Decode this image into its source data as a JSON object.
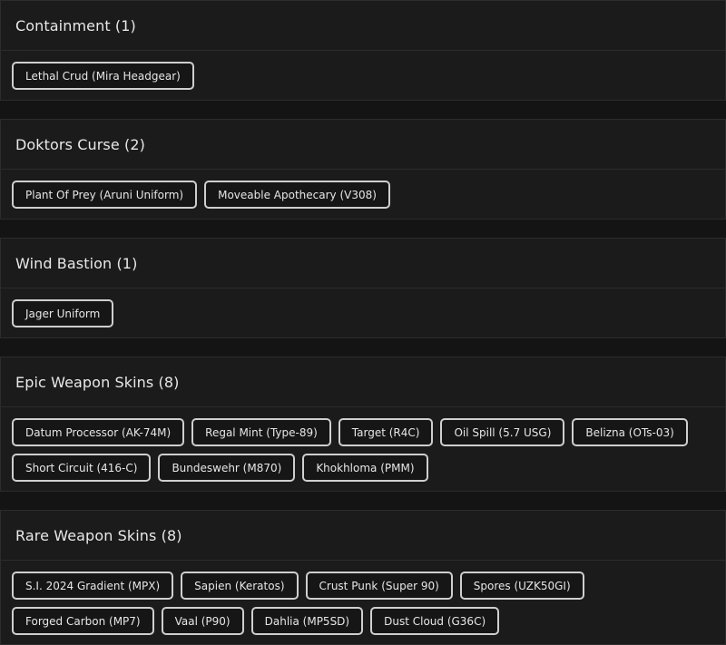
{
  "sections": [
    {
      "title": "Containment (1)",
      "items": [
        "Lethal Crud (Mira Headgear)"
      ]
    },
    {
      "title": "Doktors Curse (2)",
      "items": [
        "Plant Of Prey (Aruni Uniform)",
        "Moveable Apothecary (V308)"
      ]
    },
    {
      "title": "Wind Bastion (1)",
      "items": [
        "Jager Uniform"
      ]
    },
    {
      "title": "Epic Weapon Skins (8)",
      "items": [
        "Datum Processor (AK-74M)",
        "Regal Mint (Type-89)",
        "Target (R4C)",
        "Oil Spill (5.7 USG)",
        "Belizna (OTs-03)",
        "Short Circuit (416-C)",
        "Bundeswehr (M870)",
        "Khokhloma (PMM)"
      ]
    },
    {
      "title": "Rare Weapon Skins (8)",
      "items": [
        "S.I. 2024 Gradient (MPX)",
        "Sapien (Keratos)",
        "Crust Punk (Super 90)",
        "Spores (UZK50GI)",
        "Forged Carbon (MP7)",
        "Vaal (P90)",
        "Dahlia (MP5SD)",
        "Dust Cloud (G36C)"
      ]
    }
  ]
}
